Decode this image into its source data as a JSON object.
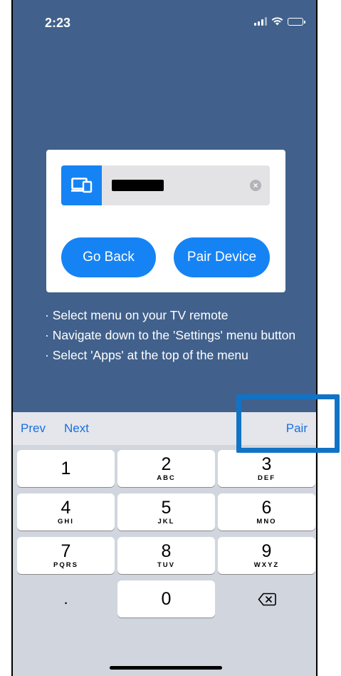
{
  "status_bar": {
    "time": "2:23",
    "icons": [
      "signal-icon",
      "wifi-icon",
      "battery-icon"
    ]
  },
  "pair_card": {
    "device_icon": "tv-device-icon",
    "device_name_value": "",
    "device_name_redacted": true,
    "clear_icon": "clear-circle-icon",
    "clear_glyph": "×",
    "go_back_label": "Go Back",
    "pair_device_label": "Pair Device"
  },
  "instructions": [
    "Select menu on your TV remote",
    "Navigate down to the 'Settings' menu button",
    "Select 'Apps' at the top of the menu"
  ],
  "keyboard": {
    "toolbar": {
      "prev": "Prev",
      "next": "Next",
      "pair": "Pair"
    },
    "keys": [
      {
        "num": "1",
        "letters": ""
      },
      {
        "num": "2",
        "letters": "ABC"
      },
      {
        "num": "3",
        "letters": "DEF"
      },
      {
        "num": "4",
        "letters": "GHI"
      },
      {
        "num": "5",
        "letters": "JKL"
      },
      {
        "num": "6",
        "letters": "MNO"
      },
      {
        "num": "7",
        "letters": "PQRS"
      },
      {
        "num": "8",
        "letters": "TUV"
      },
      {
        "num": "9",
        "letters": "WXYZ"
      },
      {
        "num": ".",
        "letters": ""
      },
      {
        "num": "0",
        "letters": ""
      },
      {
        "num": "⌫",
        "letters": "",
        "icon": "backspace-icon"
      }
    ]
  },
  "colors": {
    "background": "#41618c",
    "accent": "#1683f4",
    "highlight": "#1173c5",
    "keyboard_bg": "#d1d5de"
  }
}
